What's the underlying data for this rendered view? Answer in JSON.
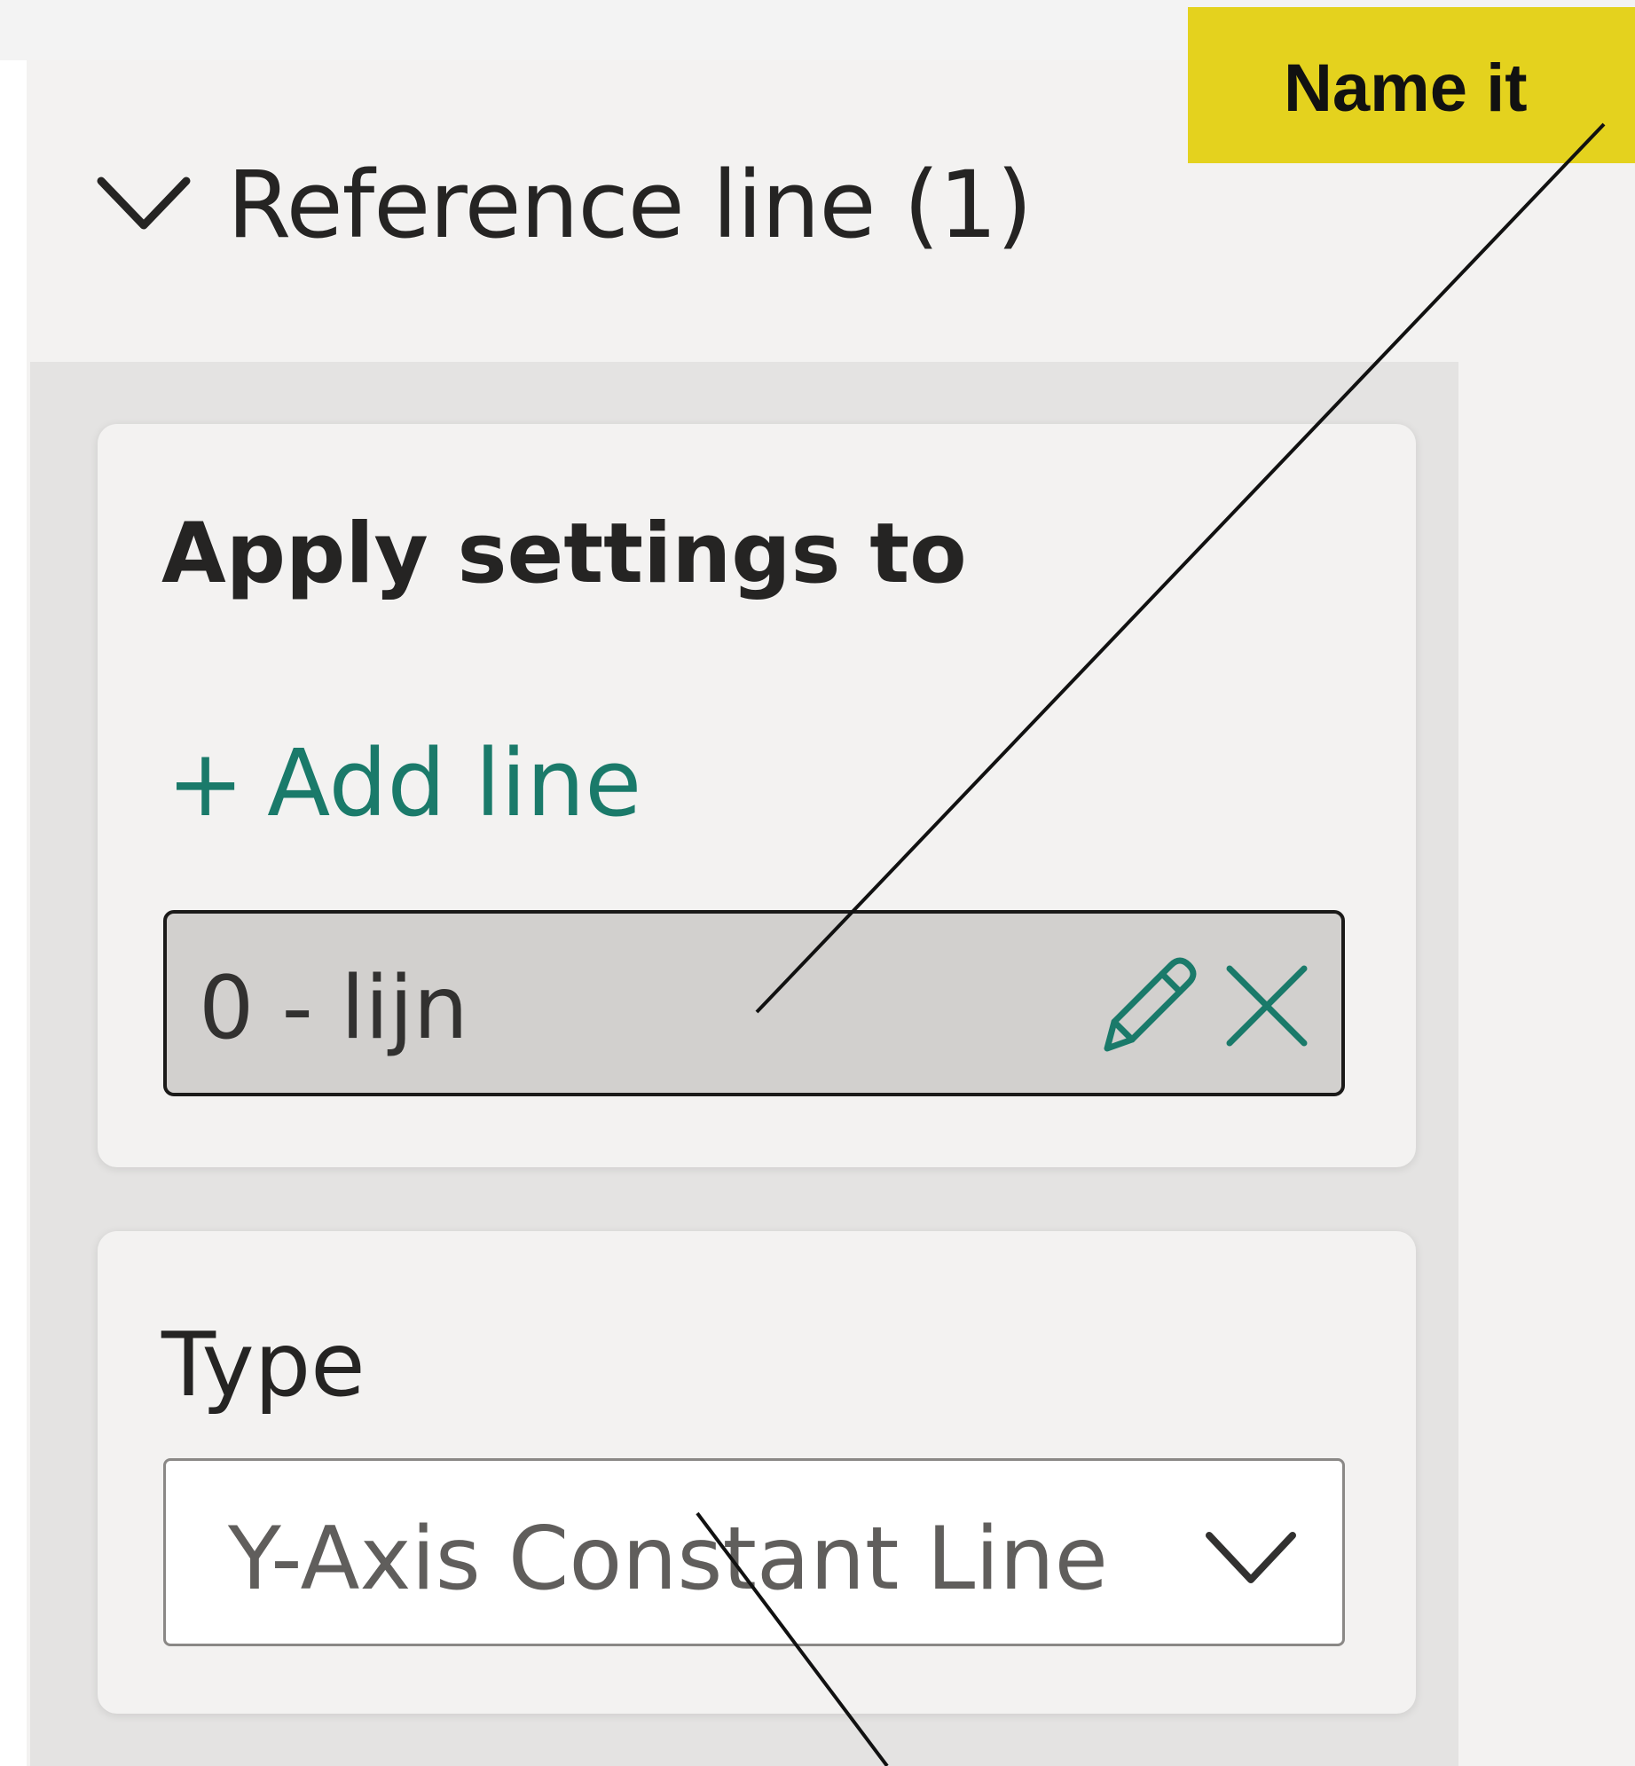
{
  "section": {
    "title": "Reference line (1)",
    "chevron_icon": "chevron-down-icon"
  },
  "apply_settings": {
    "title": "Apply settings to",
    "add_plus": "+",
    "add_label": "Add line",
    "add_color": "#1a7a6a",
    "items": [
      {
        "label": "0 - lijn",
        "edit_icon": "pencil-icon",
        "delete_icon": "close-icon"
      }
    ]
  },
  "type_field": {
    "label": "Type",
    "value": "Y-Axis Constant Line",
    "chevron_icon": "chevron-down-icon"
  },
  "annotation": {
    "callout_text": "Name it",
    "callout_color": "#e4d21e"
  }
}
